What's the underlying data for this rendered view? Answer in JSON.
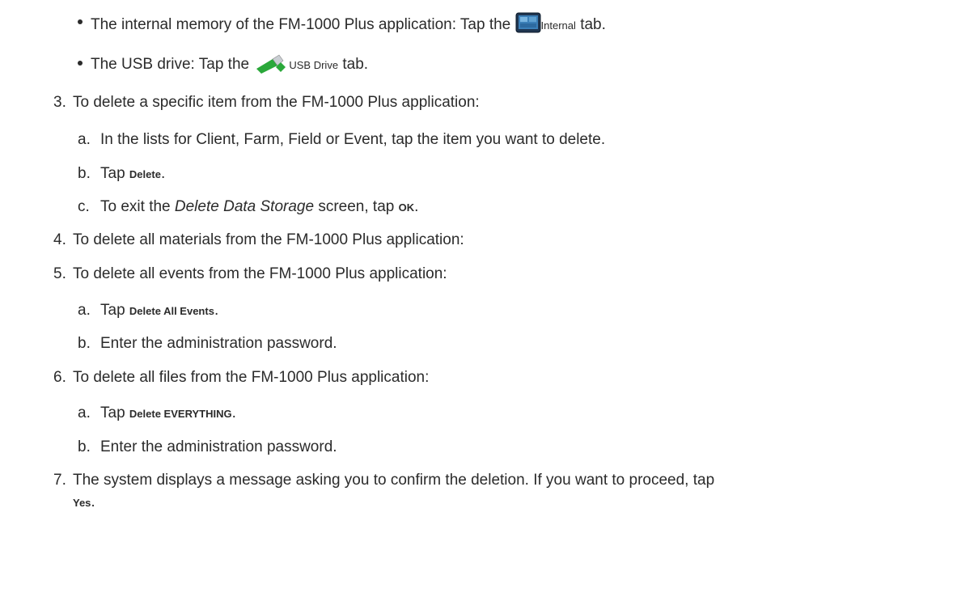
{
  "bullets": [
    {
      "before": "The internal memory of the FM-1000 Plus application: Tap the",
      "icon": "internal-tablet-icon",
      "ui_label": "Internal",
      "after": "tab."
    },
    {
      "before": "The USB drive: Tap the",
      "icon": "usb-drive-icon",
      "ui_label": "USB Drive",
      "after": "tab."
    }
  ],
  "step3": {
    "number": "3.",
    "text": "To delete a specific item from the FM-1000 Plus application:",
    "a": {
      "letter": "a.",
      "text": "In the lists for Client, Farm, Field or Event, tap the item you want to delete."
    },
    "b": {
      "letter": "b.",
      "text": "Tap",
      "ui": "Delete",
      "end": "."
    },
    "c": {
      "letter": "c.",
      "text": "To exit the",
      "italic": "Delete Data Storage",
      "text2": "screen, tap",
      "ui": "OK",
      "end": "."
    }
  },
  "step4": {
    "number": "4.",
    "text": "To delete all materials from the FM-1000 Plus application:"
  },
  "step5": {
    "number": "5.",
    "text": "To delete all events from the FM-1000 Plus application:",
    "a": {
      "letter": "a.",
      "text": "Tap",
      "ui": "Delete All Events",
      "end": "."
    },
    "b": {
      "letter": "b.",
      "text": "Enter the administration password."
    }
  },
  "step6": {
    "number": "6.",
    "text": "To delete all files from the FM-1000 Plus application:",
    "a": {
      "letter": "a.",
      "text": "Tap",
      "ui": "Delete EVERYTHING",
      "end": "."
    },
    "b": {
      "letter": "b.",
      "text": "Enter the administration password."
    }
  },
  "step7": {
    "number": "7.",
    "text": "The system displays a message asking you to confirm the deletion. If you want to proceed, tap",
    "ui": "Yes",
    "end": "."
  }
}
